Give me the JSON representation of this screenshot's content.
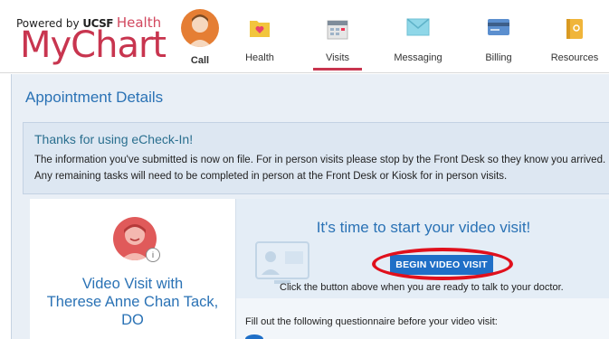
{
  "logo": {
    "powered_by": "Powered by",
    "brand": "UCSF",
    "health": "Health",
    "app_name": "MyChart"
  },
  "nav": {
    "items": [
      {
        "label": "Call",
        "icon": "call-avatar-icon",
        "active": true
      },
      {
        "label": "Health",
        "icon": "heart-folder-icon"
      },
      {
        "label": "Visits",
        "icon": "calendar-icon"
      },
      {
        "label": "Messaging",
        "icon": "envelope-icon"
      },
      {
        "label": "Billing",
        "icon": "credit-card-icon"
      },
      {
        "label": "Resources",
        "icon": "book-icon"
      }
    ]
  },
  "page": {
    "title": "Appointment Details"
  },
  "alert": {
    "title": "Thanks for using eCheck-In!",
    "text": "The information you've submitted is now on file. For in person visits please stop by the Front Desk so they know you arrived. Any remaining tasks will need to be completed in person at the Front Desk or Kiosk for in person visits."
  },
  "appointment": {
    "visit_type": "Video Visit with",
    "provider": "Therese Anne Chan Tack, DO"
  },
  "video": {
    "heading": "It's time to start your video visit!",
    "button_label": "BEGIN VIDEO VISIT",
    "note": "Click the button above when you are ready to talk to your doctor.",
    "questionnaire_note": "Fill out the following questionnaire before your video visit:"
  },
  "colors": {
    "brand": "#c8354f",
    "link_blue": "#2a72b5",
    "button_blue": "#1f6fc7",
    "highlight_ring": "#e0101c"
  }
}
